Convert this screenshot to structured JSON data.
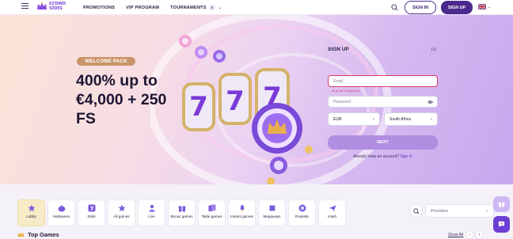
{
  "brand": {
    "logo_line1": "crown",
    "logo_line2": "slots"
  },
  "nav": {
    "promotions": "PROMOTIONS",
    "vip": "VIP PROGRAM",
    "tournaments": "TOURNAMENTS",
    "tournaments_badge": "5"
  },
  "header": {
    "signin": "SIGN IN",
    "signup": "SIGN UP"
  },
  "hero": {
    "badge": "WELCOME PACK",
    "title_line1": "400% up to",
    "title_line2": "€4,000 + 250",
    "title_line3": "FS"
  },
  "form": {
    "title": "SIGN UP",
    "step": "1/3",
    "email_placeholder": "Email",
    "email_error": "Must Be Completed",
    "password_placeholder": "Password",
    "currency": "EUR",
    "country": "South Africa",
    "next": "NEXT",
    "have_account": "Already have an account?",
    "signin_link": "Sign In"
  },
  "categories": [
    {
      "label": "Lobby",
      "icon": "star-icon",
      "active": true
    },
    {
      "label": "Halloween",
      "icon": "pumpkin-icon",
      "active": false
    },
    {
      "label": "Slots",
      "icon": "seven-icon",
      "active": false
    },
    {
      "label": "All games",
      "icon": "star-icon",
      "active": false
    },
    {
      "label": "Live",
      "icon": "live-dealer-icon",
      "active": false
    },
    {
      "label": "Bonus games",
      "icon": "gift-icon",
      "active": false
    },
    {
      "label": "Table games",
      "icon": "cards-icon",
      "active": false
    },
    {
      "label": "Instant games",
      "icon": "rocket-icon",
      "active": false
    },
    {
      "label": "Megaways",
      "icon": "clover-icon",
      "active": false
    },
    {
      "label": "Roulette",
      "icon": "roulette-icon",
      "active": false
    },
    {
      "label": "crash",
      "icon": "plane-icon",
      "active": false
    }
  ],
  "providers": {
    "placeholder": "Providers"
  },
  "top_games": {
    "title": "Top Games",
    "show_all": "Show All",
    "prev": "‹",
    "next": "›"
  },
  "colors": {
    "accent": "#4b2a8e",
    "brand_purple": "#7a3ad6",
    "active_tab": "#f8ecc8",
    "error": "#d93b6a"
  }
}
